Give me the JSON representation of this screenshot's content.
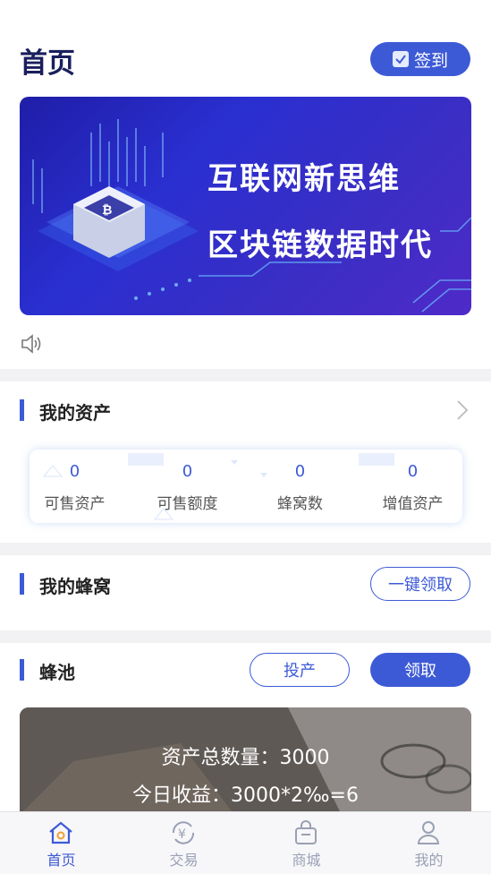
{
  "header": {
    "title": "首页",
    "signin_label": "签到"
  },
  "banner": {
    "line1": "互联网新思维",
    "line2": "区块链数据时代"
  },
  "assets": {
    "title": "我的资产",
    "items": [
      {
        "value": "0",
        "label": "可售资产"
      },
      {
        "value": "0",
        "label": "可售额度"
      },
      {
        "value": "0",
        "label": "蜂窝数"
      },
      {
        "value": "0",
        "label": "增值资产"
      }
    ]
  },
  "hive": {
    "title": "我的蜂窝",
    "claim_all_label": "一键领取"
  },
  "pool": {
    "title": "蜂池",
    "produce_label": "投产",
    "claim_label": "领取",
    "total_text": "资产总数量：3000",
    "today_text": "今日收益：3000*2‰=6"
  },
  "tabbar": {
    "items": [
      {
        "label": "首页",
        "icon": "home-icon"
      },
      {
        "label": "交易",
        "icon": "yen-exchange-icon"
      },
      {
        "label": "商城",
        "icon": "shopping-bag-icon"
      },
      {
        "label": "我的",
        "icon": "profile-icon"
      }
    ]
  },
  "colors": {
    "accent": "#3d5ad6",
    "title": "#1a1f5c"
  }
}
